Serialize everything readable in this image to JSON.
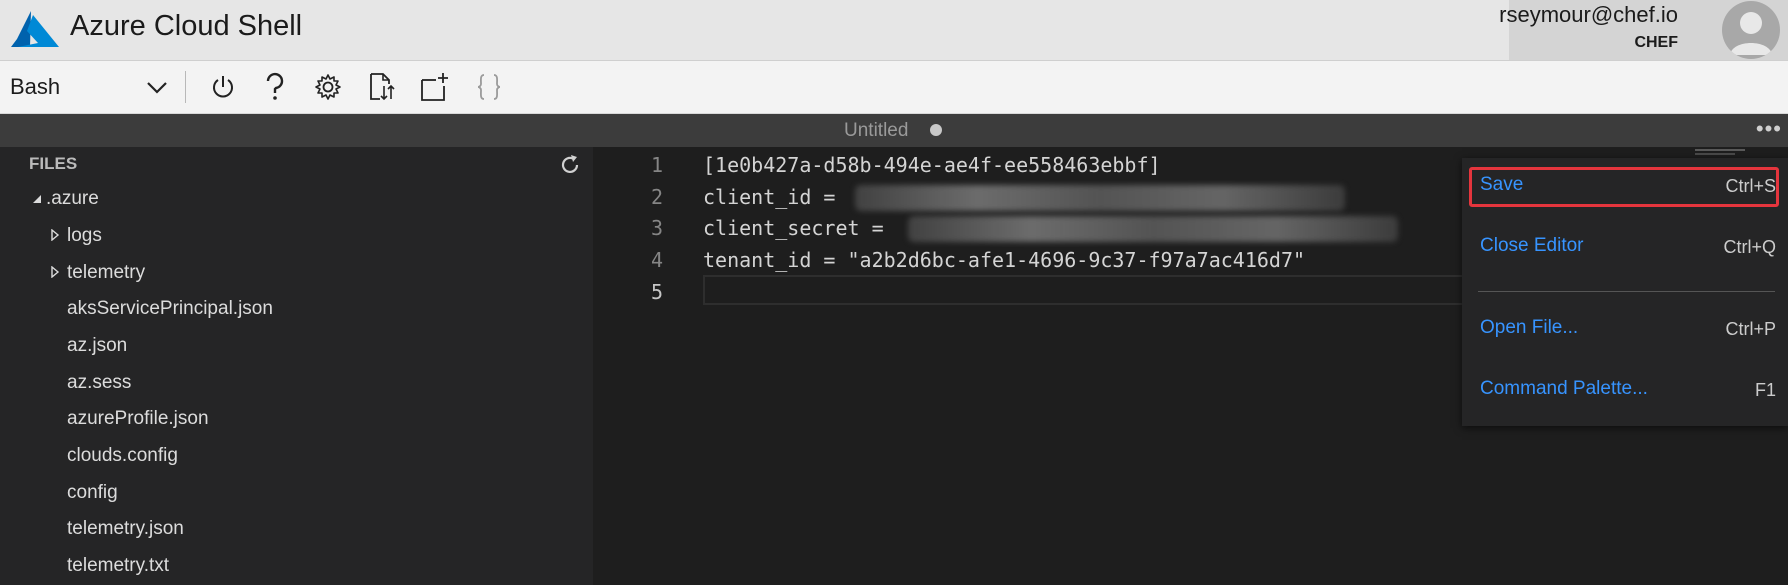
{
  "header": {
    "app_title": "Azure Cloud Shell",
    "user_email": "rseymour@chef.io",
    "user_tenant": "CHEF",
    "accent": "#0078d4"
  },
  "toolbar": {
    "shell_type": "Bash",
    "icons": [
      "power-icon",
      "help-icon",
      "settings-icon",
      "upload-download-icon",
      "new-session-icon",
      "editor-braces-icon"
    ]
  },
  "editor_tab": {
    "title": "Untitled",
    "more_label": "•••"
  },
  "explorer": {
    "header": "FILES",
    "items": [
      {
        "label": ".azure",
        "kind": "folder-open"
      },
      {
        "label": "logs",
        "kind": "folder"
      },
      {
        "label": "telemetry",
        "kind": "folder"
      },
      {
        "label": "aksServicePrincipal.json",
        "kind": "file"
      },
      {
        "label": "az.json",
        "kind": "file"
      },
      {
        "label": "az.sess",
        "kind": "file"
      },
      {
        "label": "azureProfile.json",
        "kind": "file"
      },
      {
        "label": "clouds.config",
        "kind": "file"
      },
      {
        "label": "config",
        "kind": "file"
      },
      {
        "label": "telemetry.json",
        "kind": "file"
      },
      {
        "label": "telemetry.txt",
        "kind": "file"
      }
    ]
  },
  "editor": {
    "line_numbers": [
      "1",
      "2",
      "3",
      "4",
      "5"
    ],
    "lines": [
      "[1e0b427a-d58b-494e-ae4f-ee558463ebbf]",
      "client_id = ",
      "client_secret = ",
      "tenant_id = \"a2b2d6bc-afe1-4696-9c37-f97a7ac416d7\"",
      ""
    ]
  },
  "context_menu": {
    "items": [
      {
        "label": "Save",
        "shortcut": "Ctrl+S"
      },
      {
        "label": "Close Editor",
        "shortcut": "Ctrl+Q"
      },
      {
        "label": "Open File...",
        "shortcut": "Ctrl+P"
      },
      {
        "label": "Command Palette...",
        "shortcut": "F1"
      }
    ],
    "highlight_color": "#e5353d"
  }
}
